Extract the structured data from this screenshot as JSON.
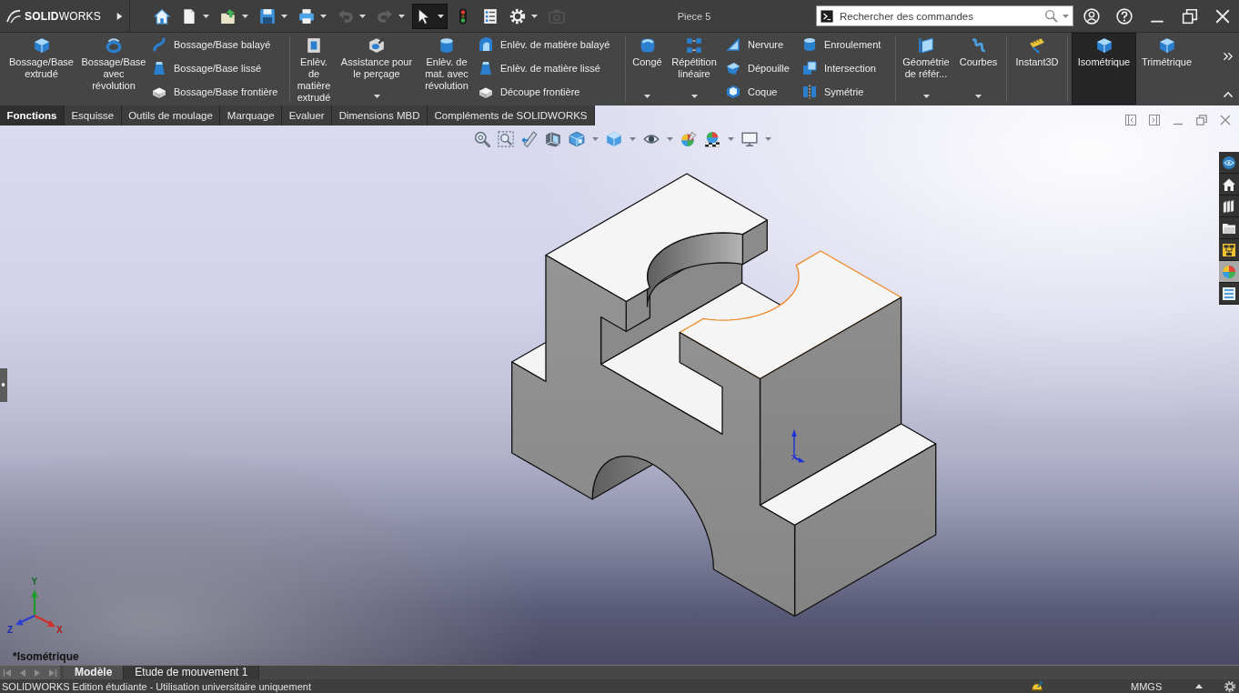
{
  "title_bar": {
    "logo": "**SOLID**WORKS",
    "document_title": "Piece 5",
    "search": {
      "placeholder": "Rechercher des commandes"
    }
  },
  "quick_access": [
    {
      "selected": false,
      "disabled": false,
      "dropdown": false
    },
    {
      "selected": false,
      "disabled": false,
      "dropdown": true
    },
    {
      "selected": false,
      "disabled": false,
      "dropdown": true
    },
    {
      "selected": false,
      "disabled": false,
      "dropdown": true
    },
    {
      "selected": false,
      "disabled": false,
      "dropdown": true
    },
    {
      "selected": false,
      "disabled": true,
      "dropdown": true
    },
    {
      "selected": false,
      "disabled": true,
      "dropdown": true
    },
    {
      "selected": true,
      "disabled": false,
      "dropdown": true
    },
    {
      "selected": false,
      "disabled": false,
      "dropdown": false
    },
    {
      "selected": false,
      "disabled": false,
      "dropdown": false
    },
    {
      "selected": false,
      "disabled": false,
      "dropdown": true
    },
    {
      "selected": false,
      "disabled": true,
      "dropdown": false
    }
  ],
  "ribbon": {
    "groups": [
      {
        "items": [
          {
            "kind": "large",
            "label": "Bossage/Base extrudé",
            "dropdown": false,
            "selected": false
          },
          {
            "kind": "large",
            "label": "Bossage/Base avec révolution",
            "dropdown": false,
            "selected": false
          },
          {
            "kind": "column",
            "items": [
              {
                "label": "Bossage/Base balayé"
              },
              {
                "label": "Bossage/Base lissé"
              },
              {
                "label": "Bossage/Base frontière"
              }
            ]
          }
        ]
      },
      {
        "items": [
          {
            "kind": "large",
            "label": "Enlèv. de matière extrudé",
            "dropdown": false,
            "selected": false
          },
          {
            "kind": "large",
            "label": "Assistance pour le perçage",
            "dropdown": true,
            "selected": false
          },
          {
            "kind": "large",
            "label": "Enlèv. de mat. avec révolution",
            "dropdown": false,
            "selected": false
          },
          {
            "kind": "column",
            "items": [
              {
                "label": "Enlèv. de matière balayé"
              },
              {
                "label": "Enlèv. de matière lissé"
              },
              {
                "label": "Découpe frontière"
              }
            ]
          }
        ]
      },
      {
        "items": [
          {
            "kind": "large",
            "label": "Congé",
            "dropdown": true,
            "selected": false
          },
          {
            "kind": "large",
            "label": "Répétition linéaire",
            "dropdown": true,
            "selected": false
          },
          {
            "kind": "column",
            "items": [
              {
                "label": "Nervure"
              },
              {
                "label": "Dépouille"
              },
              {
                "label": "Coque"
              }
            ]
          },
          {
            "kind": "column",
            "items": [
              {
                "label": "Enroulement"
              },
              {
                "label": "Intersection"
              },
              {
                "label": "Symétrie"
              }
            ]
          }
        ]
      },
      {
        "items": [
          {
            "kind": "large",
            "label": "Géométrie de référ...",
            "dropdown": true,
            "selected": false
          },
          {
            "kind": "large",
            "label": "Courbes",
            "dropdown": true,
            "selected": false
          }
        ]
      },
      {
        "items": [
          {
            "kind": "large",
            "label": "Instant3D",
            "dropdown": false,
            "selected": false
          }
        ]
      },
      {
        "items": [
          {
            "kind": "large",
            "label": "Isométrique",
            "dropdown": false,
            "selected": true
          },
          {
            "kind": "large",
            "label": "Trimétrique",
            "dropdown": false,
            "selected": false
          }
        ]
      }
    ]
  },
  "tabs": [
    {
      "label": "Fonctions",
      "selected": true
    },
    {
      "label": "Esquisse",
      "selected": false
    },
    {
      "label": "Outils de moulage",
      "selected": false
    },
    {
      "label": "Marquage",
      "selected": false
    },
    {
      "label": "Evaluer",
      "selected": false
    },
    {
      "label": "Dimensions MBD",
      "selected": false
    },
    {
      "label": "Compléments de SOLIDWORKS",
      "selected": false
    }
  ],
  "task_pane": [
    {
      "selected": false
    },
    {
      "selected": false
    },
    {
      "selected": false
    },
    {
      "selected": false
    },
    {
      "selected": false
    },
    {
      "selected": true
    },
    {
      "selected": false
    }
  ],
  "triad": {
    "x_label": "X",
    "y_label": "Y",
    "z_label": "Z"
  },
  "view_label": "*Isométrique",
  "model_tabs": [
    {
      "label": "Modèle",
      "selected": true
    },
    {
      "label": "Etude de mouvement 1",
      "selected": false
    }
  ],
  "status_bar": {
    "message": "SOLIDWORKS Edition étudiante - Utilisation universitaire uniquement",
    "units": "MMGS"
  }
}
